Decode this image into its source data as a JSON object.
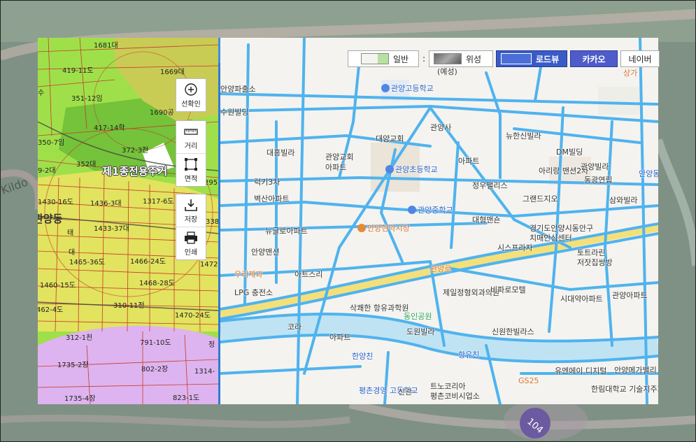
{
  "map_type_bar": {
    "general": "일반",
    "satellite": "위성",
    "roadview": "로드뷰",
    "kakao": "카카오",
    "naver": "네이버",
    "separator": ":"
  },
  "tools": {
    "view_mode": "선확인",
    "distance": "거리",
    "area": "면적",
    "save": "저장",
    "print": "인쇄"
  },
  "background_labels": {
    "kildo": "Kildo",
    "route": "104"
  },
  "cadastral": {
    "zone_label": "제1종전용주거",
    "dong_label": "관양동",
    "parcels": [
      "1681대",
      "419-11도",
      "1669대",
      "351-12임",
      "1690공",
      "417-14학",
      "350-7임",
      "372-3전",
      "352대",
      "9-2대",
      "1430-16도",
      "1436-3대",
      "1317-6도",
      "1433-37대",
      "태",
      "1465-36도",
      "1466-24도",
      "1472대",
      "1460-15도",
      "1468-28도",
      "462-4도",
      "310-11전",
      "1470-24도",
      "312-1천",
      "791-10도",
      "1735-2장",
      "802-2장",
      "1314-",
      "1735-4장",
      "823-1도",
      "수",
      "295",
      "338",
      "대",
      "정"
    ]
  },
  "road_map": {
    "pois": [
      "관양고등학교",
      "(예성)",
      "안양파출소",
      "수원빌딩",
      "관양사",
      "뉴한신빌라",
      "대양교회",
      "대흥빌라",
      "관양교회",
      "아파트",
      "관양초등학교",
      "아파트",
      "DM빌딩",
      "아리랑 맨션2차",
      "관양빌라",
      "동광연립",
      "안양동초등",
      "럭키3차",
      "벽산아파트",
      "정우팰리스",
      "그랜드지오",
      "삼와빌라",
      "관양중학교",
      "안양현약시장",
      "뉴글로아파트",
      "대형맨숀",
      "경기도안양시동안구",
      "치매안심센터",
      "안양맨션",
      "시스프라자",
      "토트라린",
      "저잣집쌍방",
      "아트스리",
      "우리제과",
      "LPG 충전소",
      "제일정형외과의원",
      "비파로모텔",
      "시대약아파트",
      "관양아파트",
      "삭쾌한 항유과학원",
      "동인공원",
      "코라",
      "아파트",
      "도원빌라",
      "신원한빌라스",
      "유엔에이 디지털",
      "안양메가밸리",
      "한양친",
      "항유친",
      "트노코리아",
      "평촌코비시업소",
      "GS25",
      "평촌경영 고등학교",
      "신관",
      "한림대학교 기술지주회사",
      "관양로",
      "상가"
    ]
  },
  "colors": {
    "road": "#4fb3ee",
    "residential_zone": "#9fe04a",
    "commercial_zone": "#e2e35f",
    "industrial_zone": "#ddb4ef",
    "accent": "#3a5bc7"
  }
}
